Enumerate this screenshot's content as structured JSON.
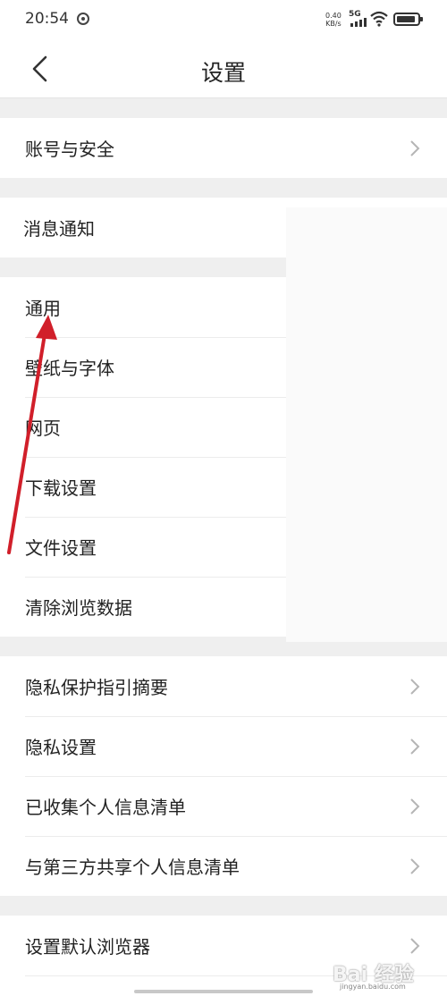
{
  "status_bar": {
    "time": "20:54",
    "speed_value": "0.40",
    "speed_unit": "KB/s",
    "network": "5G"
  },
  "navbar": {
    "title": "设置"
  },
  "groups": [
    {
      "items": [
        {
          "label": "账号与安全",
          "has_chevron": true
        }
      ]
    },
    {
      "items": [
        {
          "label": "消息通知"
        }
      ]
    },
    {
      "items": [
        {
          "label": "通用"
        },
        {
          "label": "壁纸与字体"
        },
        {
          "label": "网页"
        },
        {
          "label": "下载设置"
        },
        {
          "label": "文件设置"
        },
        {
          "label": "清除浏览数据"
        }
      ]
    },
    {
      "items": [
        {
          "label": "隐私保护指引摘要",
          "has_chevron": true
        },
        {
          "label": "隐私设置",
          "has_chevron": true
        },
        {
          "label": "已收集个人信息清单",
          "has_chevron": true
        },
        {
          "label": "与第三方共享个人信息清单",
          "has_chevron": true
        }
      ]
    },
    {
      "items": [
        {
          "label": "设置默认浏览器",
          "has_chevron": true
        }
      ]
    }
  ],
  "watermark": {
    "brand": "Bai 经验",
    "domain": "jingyan.baidu.com"
  },
  "colors": {
    "annotation_arrow": "#d11f2a",
    "chevron": "#b5b5b5"
  }
}
